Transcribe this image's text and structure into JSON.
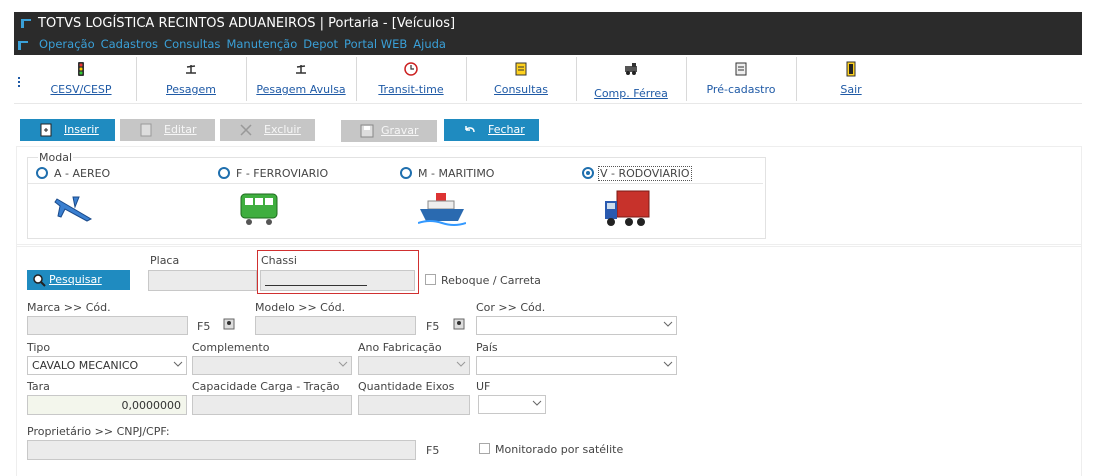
{
  "window": {
    "title": "TOTVS LOGÍSTICA RECINTOS ADUANEIROS | Portaria - [Veículos]"
  },
  "menu": [
    "Operação",
    "Cadastros",
    "Consultas",
    "Manutenção",
    "Depot",
    "Portal WEB",
    "Ajuda"
  ],
  "toolbar": [
    {
      "label": "CESV/CESP",
      "icon": "traffic-light-icon"
    },
    {
      "label": "Pesagem",
      "icon": "scale-icon"
    },
    {
      "label": "Pesagem Avulsa",
      "icon": "scale-icon"
    },
    {
      "label": "Transit-time",
      "icon": "clock-icon"
    },
    {
      "label": "Consultas",
      "icon": "printer-icon"
    },
    {
      "label": "Comp. Férrea",
      "icon": "locomotive-icon"
    },
    {
      "label": "Pré-cadastro",
      "icon": "document-icon"
    },
    {
      "label": "Sair",
      "icon": "exit-door-icon"
    }
  ],
  "actions": {
    "insert": "Inserir",
    "edit": "Editar",
    "delete": "Excluir",
    "save": "Gravar",
    "close": "Fechar"
  },
  "modal": {
    "legend": "Modal",
    "options": [
      {
        "label": "A - AEREO",
        "selected": false
      },
      {
        "label": "F - FERROVIARIO",
        "selected": false
      },
      {
        "label": "M - MARITIMO",
        "selected": false
      },
      {
        "label": "V - RODOVIARIO",
        "selected": true
      }
    ]
  },
  "form": {
    "search_button": "Pesquisar",
    "placa_label": "Placa",
    "chassi_label": "Chassi",
    "reboque_label": "Reboque / Carreta",
    "marca_label": "Marca >> Cód.",
    "modelo_label": "Modelo >> Cód.",
    "cor_label": "Cor >> Cód.",
    "f5": "F5",
    "tipo_label": "Tipo",
    "tipo_value": "CAVALO MECANICO",
    "complemento_label": "Complemento",
    "ano_label": "Ano Fabricação",
    "pais_label": "País",
    "tara_label": "Tara",
    "tara_value": "0,0000000",
    "capacidade_label": "Capacidade Carga - Tração",
    "eixos_label": "Quantidade Eixos",
    "uf_label": "UF",
    "proprietario_label": "Proprietário >> CNPJ/CPF:",
    "monitorado_label": "Monitorado por satélite"
  },
  "colors": {
    "title_bg": "#2b2b2b",
    "menu_text": "#3aa0d8",
    "button_active": "#1f8bc0",
    "button_disabled": "#c6c6c6",
    "highlight_border": "#d03030"
  }
}
